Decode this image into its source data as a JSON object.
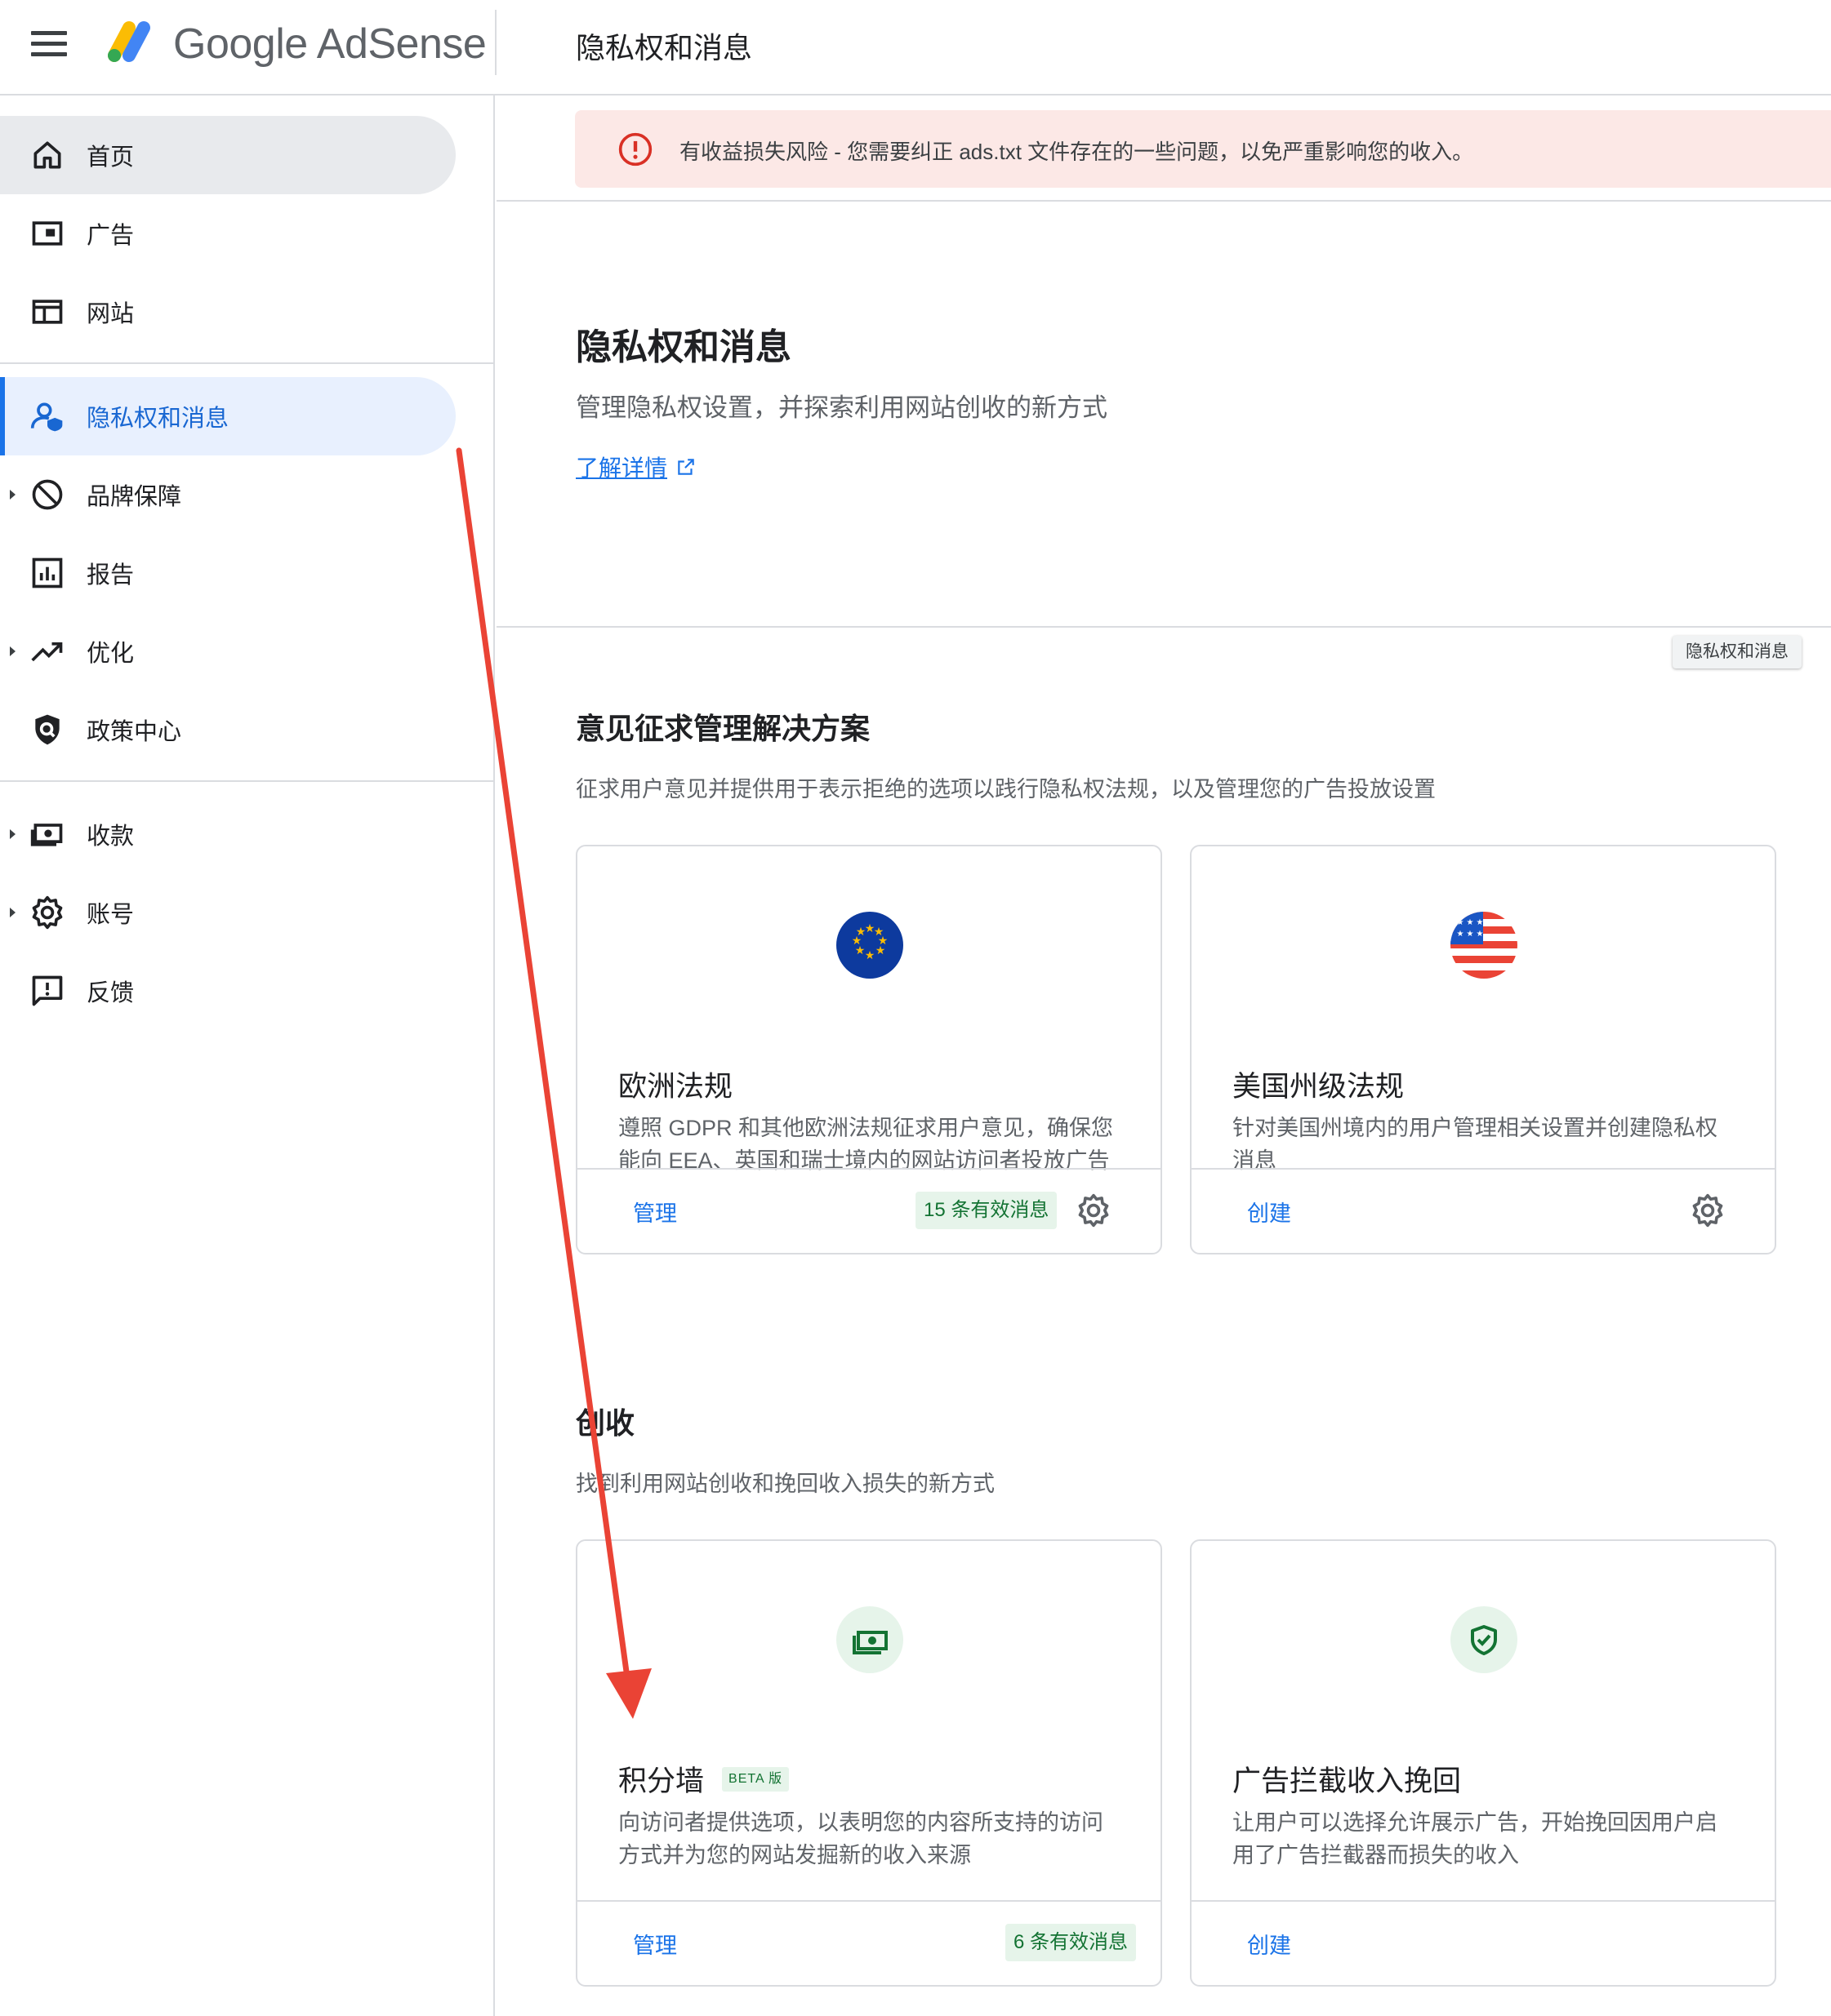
{
  "app": {
    "brand": "Google AdSense",
    "page_header": "隐私权和消息"
  },
  "sidebar": {
    "items": [
      {
        "label": "首页",
        "icon": "home-icon"
      },
      {
        "label": "广告",
        "icon": "ads-icon"
      },
      {
        "label": "网站",
        "icon": "sites-icon"
      },
      {
        "label": "隐私权和消息",
        "icon": "privacy-user-icon"
      },
      {
        "label": "品牌保障",
        "icon": "block-icon"
      },
      {
        "label": "报告",
        "icon": "report-chart-icon"
      },
      {
        "label": "优化",
        "icon": "trending-up-icon"
      },
      {
        "label": "政策中心",
        "icon": "policy-shield-icon"
      },
      {
        "label": "收款",
        "icon": "payments-icon"
      },
      {
        "label": "账号",
        "icon": "settings-gear-icon"
      },
      {
        "label": "反馈",
        "icon": "feedback-icon"
      }
    ]
  },
  "alert": {
    "text": "有收益损失风险 - 您需要纠正 ads.txt 文件存在的一些问题，以免严重影响您的收入。"
  },
  "hero": {
    "title": "隐私权和消息",
    "subtitle": "管理隐私权设置，并探索利用网站创收的新方式",
    "link": "了解详情"
  },
  "tooltip_chip": "隐私权和消息",
  "consent_section": {
    "title": "意见征求管理解决方案",
    "subtitle": "征求用户意见并提供用于表示拒绝的选项以践行隐私权法规，以及管理您的广告投放设置",
    "cards": [
      {
        "title": "欧洲法规",
        "desc": "遵照 GDPR 和其他欧洲法规征求用户意见，确保您能向 EEA、英国和瑞士境内的网站访问者投放广告",
        "action": "管理",
        "count": "15 条有效消息"
      },
      {
        "title": "美国州级法规",
        "desc": "针对美国州境内的用户管理相关设置并创建隐私权消息",
        "action": "创建"
      }
    ]
  },
  "monetize_section": {
    "title": "创收",
    "subtitle": "找到利用网站创收和挽回收入损失的新方式",
    "cards": [
      {
        "title": "积分墙",
        "badge": "BETA 版",
        "desc": "向访问者提供选项，以表明您的内容所支持的访问方式并为您的网站发掘新的收入来源",
        "action": "管理",
        "count": "6 条有效消息"
      },
      {
        "title": "广告拦截收入挽回",
        "desc": "让用户可以选择允许展示广告，开始挽回因用户启用了广告拦截器而损失的收入",
        "action": "创建"
      }
    ]
  },
  "colors": {
    "accent": "#1a73e8",
    "alert_bg": "#fce8e6",
    "alert_icon": "#d93025",
    "success": "#137333",
    "annotation_arrow": "#ea4335"
  }
}
